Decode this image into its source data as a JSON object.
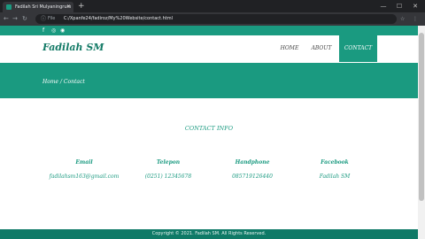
{
  "browser": {
    "tab_title": "Fadilah Sri Mulyaningrum",
    "new_tab_symbol": "+",
    "address_label": "File",
    "url": "C:/Xpanfe24/fadiroz/My%20Website/contact.html"
  },
  "site": {
    "brand": "Fadilah SM",
    "nav": [
      {
        "label": "HOME"
      },
      {
        "label": "ABOUT"
      },
      {
        "label": "CONTACT"
      }
    ],
    "breadcrumb": "Home / Contact",
    "section_title": "CONTACT INFO",
    "contacts": [
      {
        "heading": "Email",
        "value": "fadilahsm163@gmail.com"
      },
      {
        "heading": "Telepon",
        "value": "(0251) 12345678"
      },
      {
        "heading": "Handphone",
        "value": "085719126440"
      },
      {
        "heading": "Facebook",
        "value": "Fadilah SM"
      }
    ],
    "footer": "Copyright © 2021. Fadilah SM. All Rights Reserved."
  },
  "colors": {
    "primary": "#1a9a80",
    "footer": "#0f7a67",
    "browser_dark": "#202124"
  }
}
